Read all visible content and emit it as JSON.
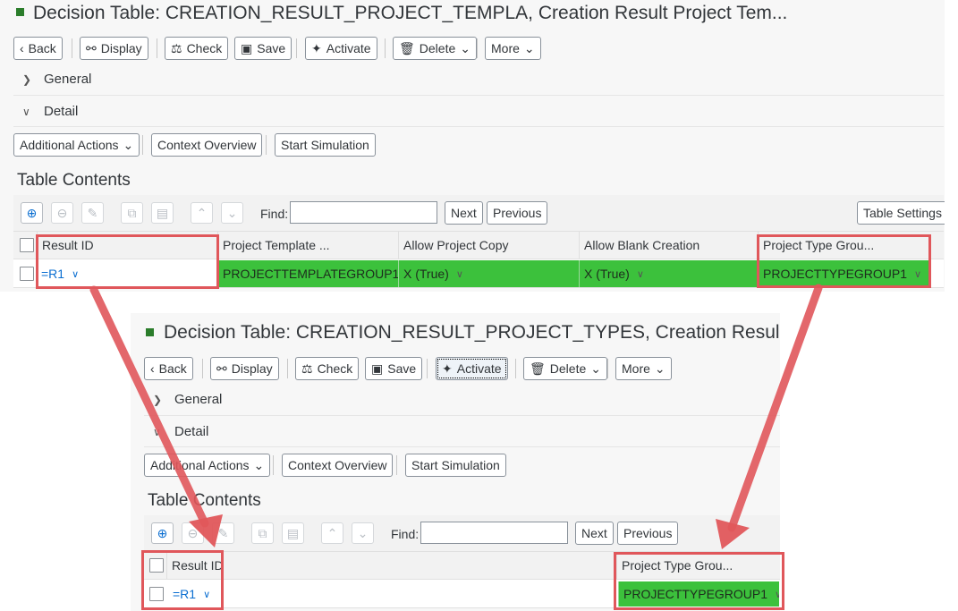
{
  "top_window": {
    "title": "Decision Table: CREATION_RESULT_PROJECT_TEMPLA, Creation Result Project Tem...",
    "toolbar": {
      "back": "Back",
      "display": "Display",
      "check": "Check",
      "save": "Save",
      "activate": "Activate",
      "delete": "Delete",
      "more": "More"
    },
    "sections": {
      "general": "General",
      "detail": "Detail"
    },
    "detail_actions": {
      "additional_actions": "Additional Actions",
      "context_overview": "Context Overview",
      "start_simulation": "Start Simulation"
    },
    "table_heading": "Table Contents",
    "find_label": "Find:",
    "next": "Next",
    "previous": "Previous",
    "table_settings": "Table Settings",
    "columns": [
      "Result ID",
      "Project Template ...",
      "Allow Project Copy",
      "Allow Blank Creation",
      "Project Type Grou..."
    ],
    "row": [
      "=R1",
      "PROJECTTEMPLATEGROUP1",
      "X (True)",
      "X (True)",
      "PROJECTTYPEGROUP1"
    ]
  },
  "bottom_window": {
    "title": "Decision Table: CREATION_RESULT_PROJECT_TYPES, Creation Resul",
    "toolbar": {
      "back": "Back",
      "display": "Display",
      "check": "Check",
      "save": "Save",
      "activate": "Activate",
      "delete": "Delete",
      "more": "More"
    },
    "sections": {
      "general": "General",
      "detail": "Detail"
    },
    "detail_actions": {
      "additional_actions": "Additional Actions",
      "context_overview": "Context Overview",
      "start_simulation": "Start Simulation"
    },
    "table_heading": "Table Contents",
    "find_label": "Find:",
    "next": "Next",
    "previous": "Previous",
    "columns": [
      "Result ID",
      "Project Type Grou..."
    ],
    "row": [
      "=R1",
      "PROJECTTYPEGROUP1"
    ]
  },
  "colors": {
    "highlight_red": "#e0575b",
    "value_green": "#3cc13c",
    "link_blue": "#0a6ed1"
  }
}
